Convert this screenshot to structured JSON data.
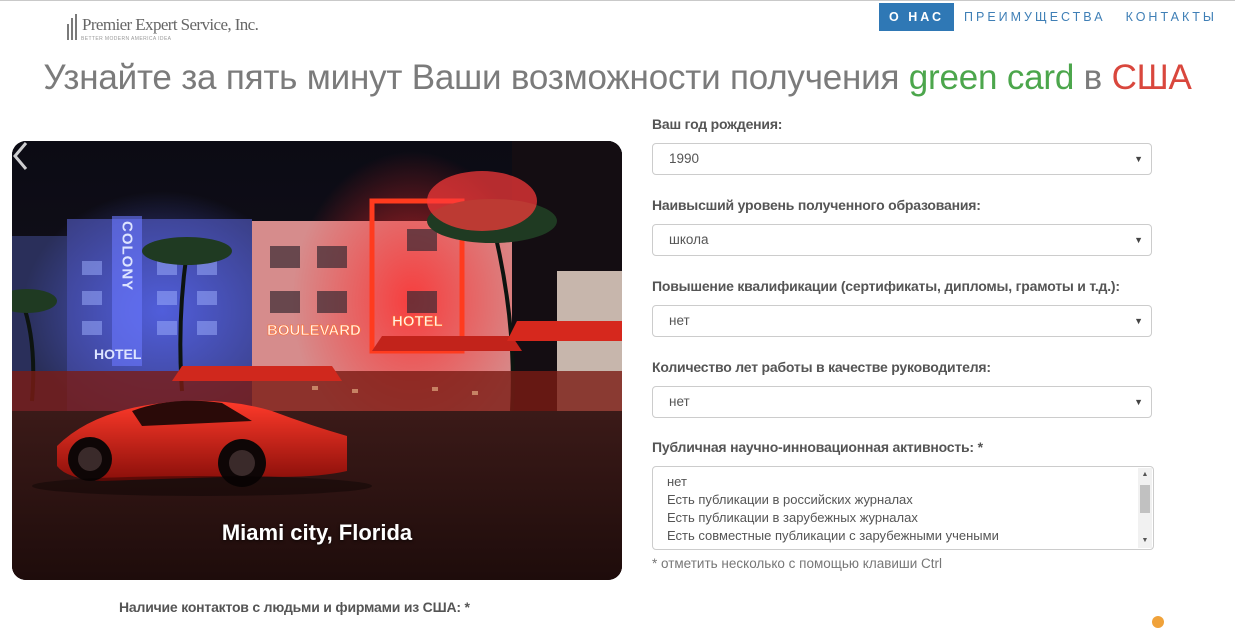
{
  "logo": {
    "name": "Premier Expert Service, Inc.",
    "tagline": "BETTER MODERN AMERICA IDEA"
  },
  "nav": {
    "items": [
      "О НАС",
      "ПРЕИМУЩЕСТВА",
      "КОНТАКТЫ"
    ],
    "active": "О НАС"
  },
  "headline": {
    "part1": "Узнайте за пять минут Ваши возможности получения ",
    "green": "green card",
    "part2": " в ",
    "red": "США"
  },
  "hero": {
    "caption": "Miami city, Florida",
    "signs": {
      "colony": "COLONY",
      "hotel_left": "HOTEL",
      "boulevard": "BOULEVARD",
      "hotel_right": "HOTEL"
    }
  },
  "form": {
    "birth_year": {
      "label": "Ваш год рождения:",
      "value": "1990"
    },
    "education": {
      "label": "Наивысший уровень полученного образования:",
      "value": "школа"
    },
    "qualification": {
      "label": "Повышение квалификации (сертификаты, дипломы, грамоты и т.д.):",
      "value": "нет"
    },
    "management_years": {
      "label": "Количество лет работы в качестве руководителя:",
      "value": "нет"
    },
    "research_activity": {
      "label": "Публичная научно-инновационная активность: *",
      "options": [
        "нет",
        "Есть публикации в российских журналах",
        "Есть публикации в зарубежных журналах",
        "Есть совместные публикации с зарубежными учеными"
      ],
      "hint": "* отметить несколько с помощью клавиши Ctrl"
    },
    "us_contacts": {
      "label": "Наличие контактов с людьми и фирмами из США: *"
    }
  },
  "colors": {
    "accent": "#2f78b5",
    "green": "#4ca64c",
    "red": "#d9473d"
  }
}
